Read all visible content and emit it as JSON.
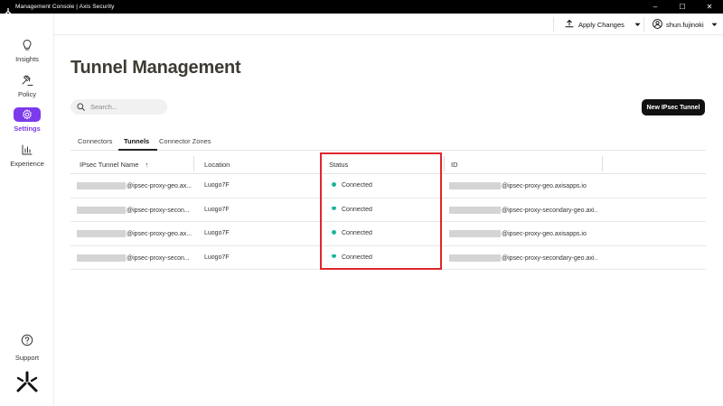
{
  "window": {
    "title": "Management Console | Axis Security",
    "controls": [
      "–",
      "☐",
      "✕"
    ]
  },
  "sidebar": {
    "items": [
      {
        "label": "Insights",
        "icon": "lightbulb-icon",
        "active": false
      },
      {
        "label": "Policy",
        "icon": "gavel-icon",
        "active": false
      },
      {
        "label": "Settings",
        "icon": "gear-icon",
        "active": true
      },
      {
        "label": "Experience",
        "icon": "bar-chart-icon",
        "active": false
      }
    ],
    "support_label": "Support"
  },
  "header": {
    "apply_label": "Apply Changes",
    "user_name": "shun.fujinoki"
  },
  "page": {
    "title": "Tunnel Management"
  },
  "search": {
    "placeholder": "Search..."
  },
  "actions": {
    "new_tunnel_label": "New IPsec Tunnel"
  },
  "tabs": [
    {
      "label": "Connectors",
      "active": false
    },
    {
      "label": "Tunnels",
      "active": true
    },
    {
      "label": "Connector Zones",
      "active": false
    }
  ],
  "table": {
    "columns": [
      "IPsec Tunnel Name",
      "Location",
      "Status",
      "ID"
    ],
    "sort_indicator": "↑",
    "rows": [
      {
        "name": "@ipsec-proxy-geo.ax...",
        "location": "Luogo7F",
        "status": "Connected",
        "id": "@ipsec-proxy-geo.axisapps.io"
      },
      {
        "name": "@ipsec-proxy-secon...",
        "location": "Luogo7F",
        "status": "Connected",
        "id": "@ipsec-proxy-secondary-geo.axi..."
      },
      {
        "name": "@ipsec-proxy-geo.ax...",
        "location": "Luogo7F",
        "status": "Connected",
        "id": "@ipsec-proxy-geo.axisapps.io"
      },
      {
        "name": "@ipsec-proxy-secon...",
        "location": "Luogo7F",
        "status": "Connected",
        "id": "@ipsec-proxy-secondary-geo.axi..."
      }
    ]
  },
  "colors": {
    "accent": "#7c3aed",
    "status_connected": "#1fb59b",
    "highlight": "#e0262b"
  }
}
